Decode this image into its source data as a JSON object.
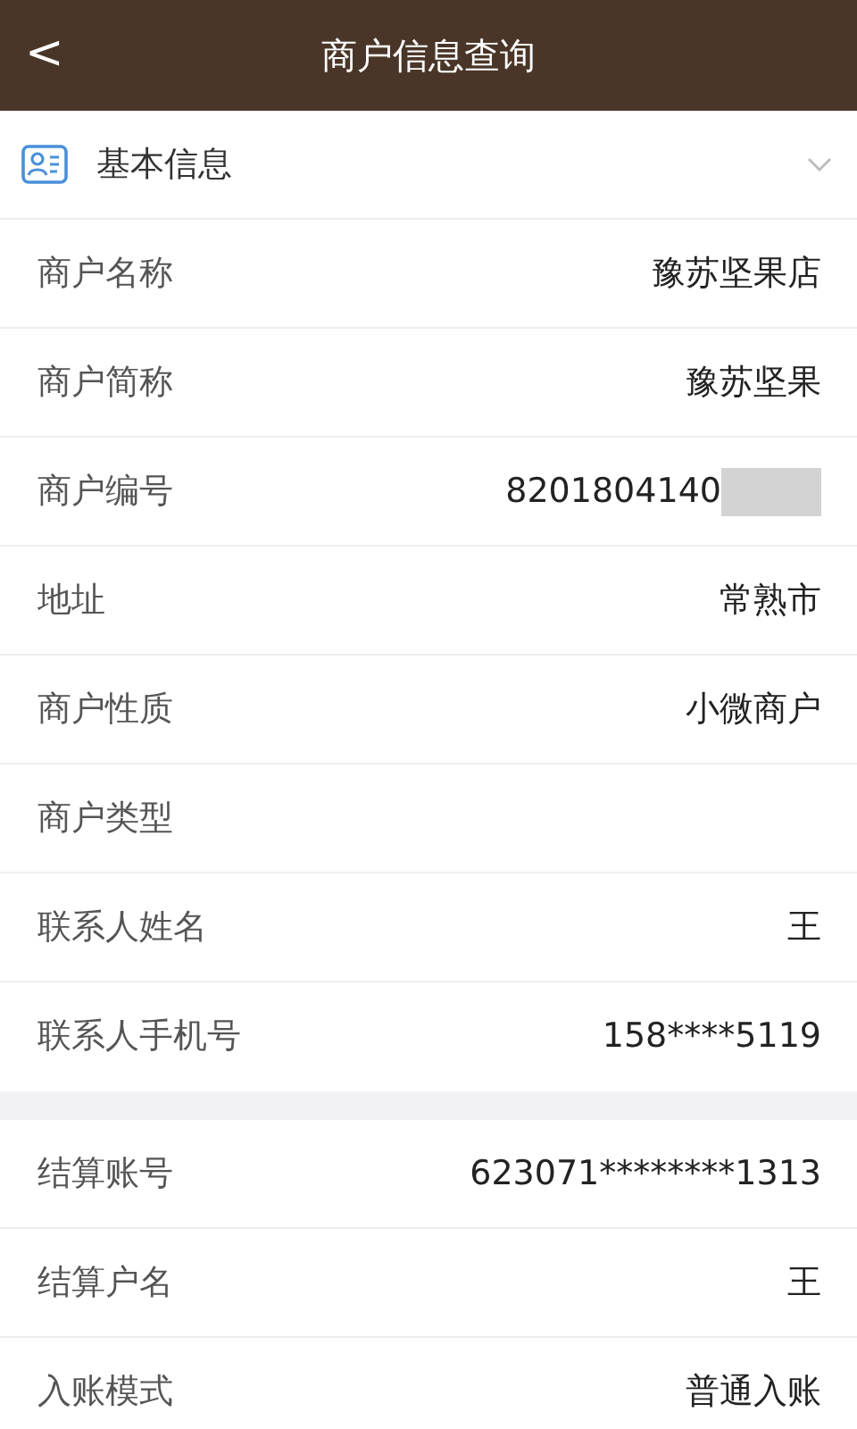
{
  "header": {
    "back": "<",
    "title": "商户信息查询"
  },
  "section": {
    "title": "基本信息",
    "expanded": true
  },
  "groups": [
    {
      "rows": [
        {
          "label": "商户名称",
          "value": "豫苏坚果店"
        },
        {
          "label": "商户简称",
          "value": "豫苏坚果"
        },
        {
          "label": "商户编号",
          "value": "8201804140",
          "redacted": true
        },
        {
          "label": "地址",
          "value": "常熟市"
        },
        {
          "label": "商户性质",
          "value": "小微商户"
        },
        {
          "label": "商户类型"
        },
        {
          "label": "联系人姓名",
          "value": "王"
        },
        {
          "label": "联系人手机号",
          "value": "158****5119"
        }
      ]
    },
    {
      "rows": [
        {
          "label": "结算账号",
          "value": "623071********1313"
        },
        {
          "label": "结算户名",
          "value": "王"
        },
        {
          "label": "入账模式",
          "value": "普通入账"
        }
      ]
    }
  ]
}
